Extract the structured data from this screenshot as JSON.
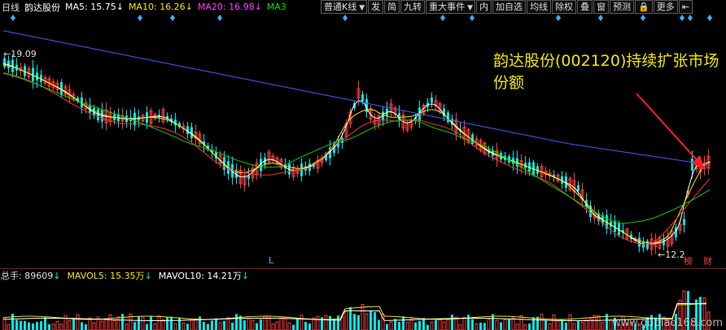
{
  "period_label": "日线",
  "stock_name": "韵达股份",
  "ma": [
    {
      "label": "MA5: 15.75",
      "arrow": "↓",
      "color": "#ffffff"
    },
    {
      "label": "MA10: 16.26",
      "arrow": "↓",
      "color": "#f2e600"
    },
    {
      "label": "MA20: 16.98",
      "arrow": "↓",
      "color": "#ff3cff"
    },
    {
      "label": "MA3",
      "arrow": "",
      "color": "#00e000"
    }
  ],
  "toolbar": [
    {
      "label": "普通K线",
      "dropdown": true
    },
    {
      "label": "发"
    },
    {
      "label": "简"
    },
    {
      "label": "九转"
    },
    {
      "label": "重大事件",
      "dropdown": true
    },
    {
      "label": "内"
    },
    {
      "label": "加自选"
    },
    {
      "label": "均线"
    },
    {
      "label": "除权"
    },
    {
      "label": "叠"
    },
    {
      "label": "窗"
    },
    {
      "label": "预测"
    },
    {
      "label": "lock",
      "icon": "lock-icon",
      "glyph": "🔒"
    },
    {
      "label": "更多"
    },
    {
      "label": "collapse",
      "icon": "collapse-left-icon",
      "glyph": "⇤"
    }
  ],
  "price_labels": {
    "high": "19.09",
    "low": "12.2",
    "l_marker": "L",
    "bang": "榜",
    "cai": "财"
  },
  "annotation": "韵达股份(002120)持续扩张市场份额",
  "volume": {
    "total_label": "总手:",
    "total_value": "89609",
    "total_arrow": "↓",
    "mavol5": "MAVOL5: 15.35万",
    "mavol5_arrow": "↓",
    "mavol10": "MAVOL10: 14.21万",
    "mavol10_arrow": "↓"
  },
  "watermark": "www.gupiao168.com",
  "colors": {
    "up": "#ff3c3c",
    "down": "#00e6e6",
    "ma5": "#ffffff",
    "ma10": "#f2e600",
    "ma20": "#ff3cff",
    "ma30": "#00d000",
    "ma60": "#3a5fff",
    "ma_red": "#ff3030",
    "annotation": "#f2e600",
    "arrow": "#ff2020"
  }
}
